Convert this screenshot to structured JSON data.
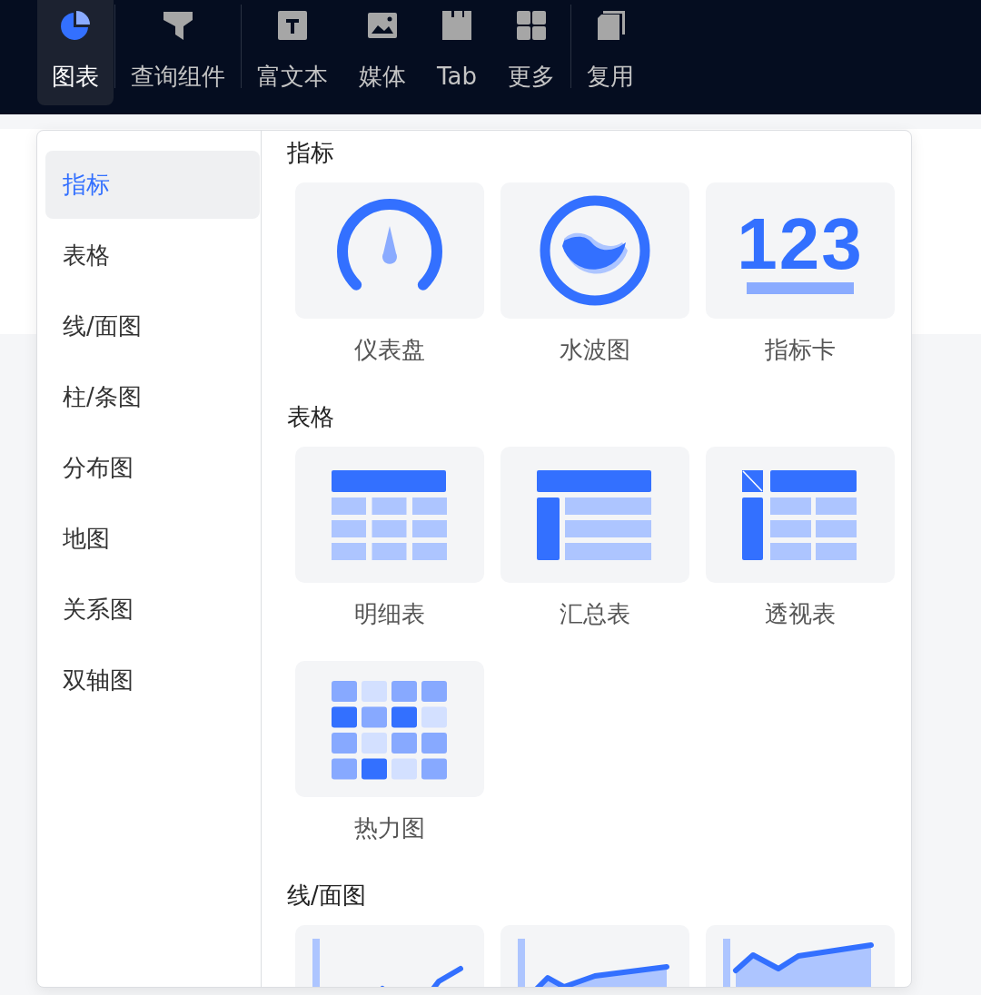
{
  "toolbar": [
    {
      "items": [
        {
          "label": "图表",
          "kind": "chart",
          "selected": true
        }
      ]
    },
    {
      "items": [
        {
          "label": "查询组件",
          "kind": "filter",
          "selected": false
        }
      ]
    },
    {
      "items": [
        {
          "label": "富文本",
          "kind": "text",
          "selected": false
        },
        {
          "label": "媒体",
          "kind": "media",
          "selected": false
        },
        {
          "label": "Tab",
          "kind": "tab",
          "selected": false
        },
        {
          "label": "更多",
          "kind": "more",
          "selected": false
        }
      ]
    },
    {
      "items": [
        {
          "label": "复用",
          "kind": "copy",
          "selected": false
        }
      ]
    }
  ],
  "sidebar": {
    "items": [
      {
        "label": "指标",
        "selected": true
      },
      {
        "label": "表格",
        "selected": false
      },
      {
        "label": "线/面图",
        "selected": false
      },
      {
        "label": "柱/条图",
        "selected": false
      },
      {
        "label": "分布图",
        "selected": false
      },
      {
        "label": "地图",
        "selected": false
      },
      {
        "label": "关系图",
        "selected": false
      },
      {
        "label": "双轴图",
        "selected": false
      }
    ]
  },
  "sections": [
    {
      "title": "指标",
      "items": [
        {
          "kind": "gauge",
          "label": "仪表盘"
        },
        {
          "kind": "liquid",
          "label": "水波图"
        },
        {
          "kind": "kpi",
          "icon_text": "123",
          "label": "指标卡"
        }
      ]
    },
    {
      "title": "表格",
      "items": [
        {
          "kind": "detail-table",
          "label": "明细表"
        },
        {
          "kind": "summary-table",
          "label": "汇总表"
        },
        {
          "kind": "pivot-table",
          "label": "透视表"
        },
        {
          "kind": "heatmap",
          "label": "热力图"
        }
      ]
    },
    {
      "title": "线/面图",
      "items": [
        {
          "kind": "line"
        },
        {
          "kind": "line-area"
        },
        {
          "kind": "area"
        }
      ]
    }
  ]
}
